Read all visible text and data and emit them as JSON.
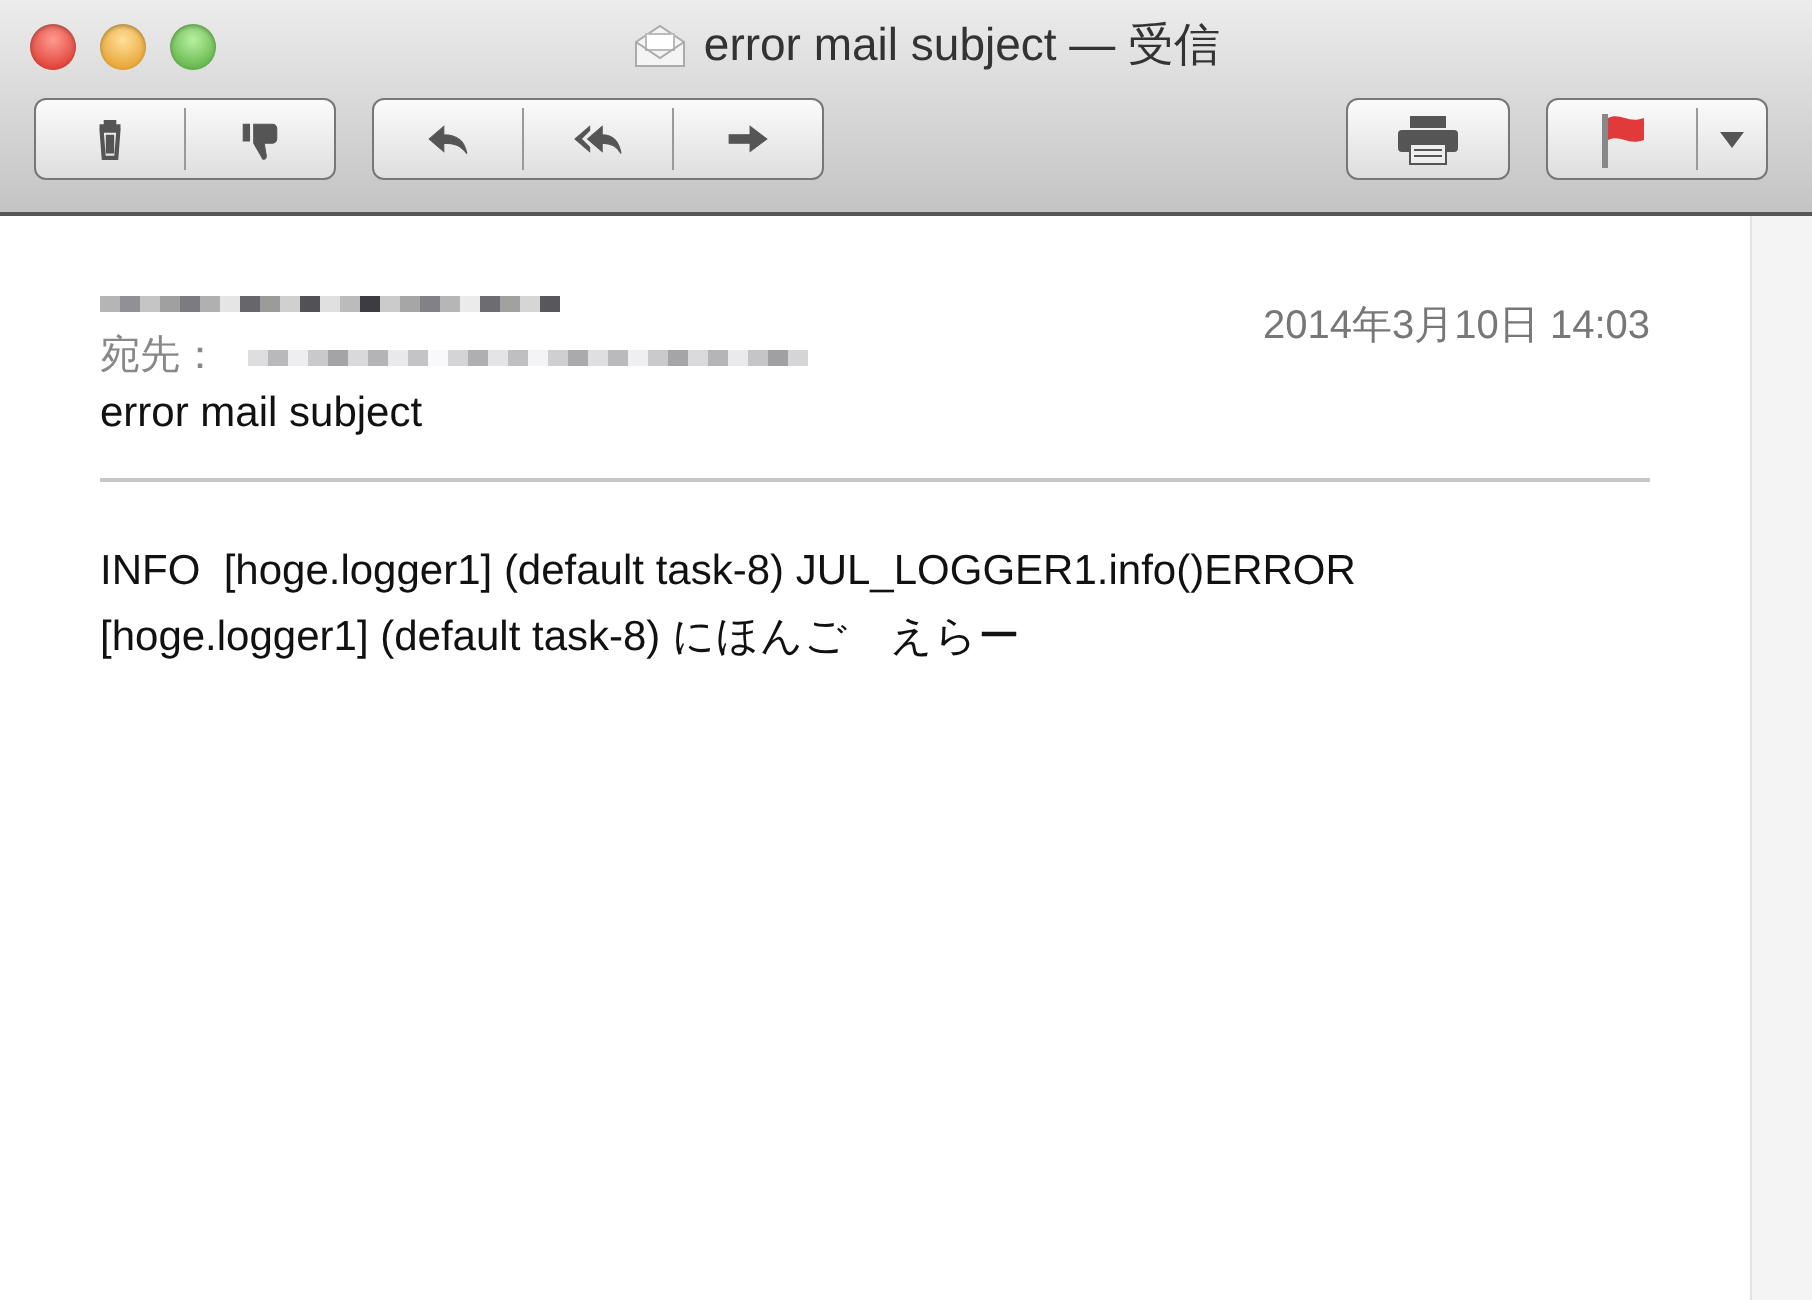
{
  "window": {
    "title": "error mail subject — 受信"
  },
  "toolbar": {
    "groups": [
      {
        "buttons": [
          {
            "kind": "trash"
          },
          {
            "kind": "junk"
          }
        ]
      },
      {
        "buttons": [
          {
            "kind": "reply"
          },
          {
            "kind": "reply_all"
          },
          {
            "kind": "forward"
          }
        ]
      },
      {
        "buttons": [
          {
            "kind": "print"
          }
        ]
      },
      {
        "buttons": [
          {
            "kind": "flag"
          },
          {
            "kind": "dropdown"
          }
        ]
      }
    ]
  },
  "message": {
    "date": "2014年3月10日 14:03",
    "to_label": "宛先：",
    "subject": "error mail subject",
    "body": "INFO  [hoge.logger1] (default task-8) JUL_LOGGER1.info()ERROR [hoge.logger1] (default task-8) にほんご　えらー"
  }
}
